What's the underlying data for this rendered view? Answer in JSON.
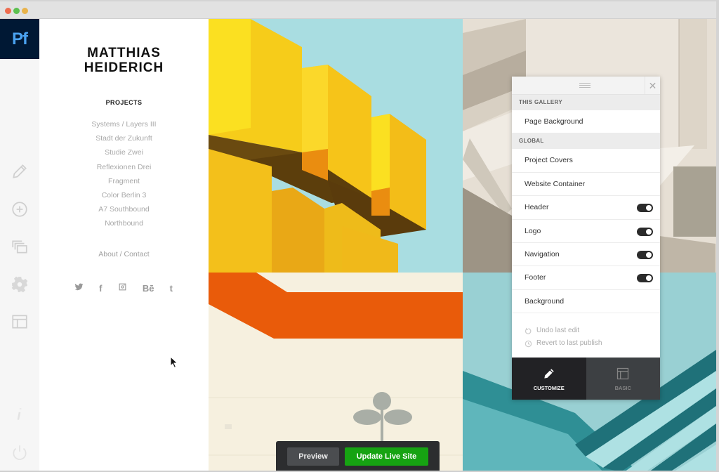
{
  "window": {
    "traffic_lights": [
      "close",
      "minimize",
      "zoom"
    ]
  },
  "app": {
    "logo_text": "Pf",
    "logo_bg": "#001834",
    "logo_fg": "#4aa2f0"
  },
  "rail": {
    "items": [
      {
        "icon": "pencil-icon",
        "label": "Edit"
      },
      {
        "icon": "plus-circle-icon",
        "label": "Add"
      },
      {
        "icon": "pages-icon",
        "label": "Pages"
      },
      {
        "icon": "gear-icon",
        "label": "Settings"
      },
      {
        "icon": "layout-icon",
        "label": "Layout"
      }
    ],
    "bottom": [
      {
        "icon": "info-icon",
        "label": "Info"
      },
      {
        "icon": "power-icon",
        "label": "Logout"
      }
    ]
  },
  "site": {
    "title_line1": "MATTHIAS",
    "title_line2": "HEIDERICH",
    "projects_heading": "PROJECTS",
    "projects": [
      "Systems / Layers III",
      "Stadt der Zukunft",
      "Studie Zwei",
      "Reflexionen Drei",
      "Fragment",
      "Color Berlin 3",
      "A7 Southbound",
      "Northbound"
    ],
    "about_link": "About / Contact",
    "social": [
      {
        "icon": "twitter-icon",
        "glyph": ""
      },
      {
        "icon": "facebook-icon",
        "glyph": "f"
      },
      {
        "icon": "instagram-icon",
        "glyph": ""
      },
      {
        "icon": "behance-icon",
        "glyph": "Bē"
      },
      {
        "icon": "tumblr-icon",
        "glyph": "t"
      }
    ]
  },
  "panel": {
    "sections": [
      {
        "heading": "THIS GALLERY",
        "rows": [
          {
            "label": "Page Background"
          }
        ]
      },
      {
        "heading": "GLOBAL",
        "rows": [
          {
            "label": "Project Covers"
          },
          {
            "label": "Website Container"
          },
          {
            "label": "Header",
            "toggle": true,
            "on": true
          },
          {
            "label": "Logo",
            "toggle": true,
            "on": true
          },
          {
            "label": "Navigation",
            "toggle": true,
            "on": true
          },
          {
            "label": "Footer",
            "toggle": true,
            "on": true
          },
          {
            "label": "Background"
          }
        ]
      }
    ],
    "undo_label": "Undo last edit",
    "revert_label": "Revert to last publish",
    "modes": [
      {
        "label": "CUSTOMIZE",
        "active": true
      },
      {
        "label": "BASIC",
        "active": false
      }
    ]
  },
  "actions": {
    "preview_label": "Preview",
    "update_label": "Update Live Site",
    "update_color": "#16a312"
  }
}
